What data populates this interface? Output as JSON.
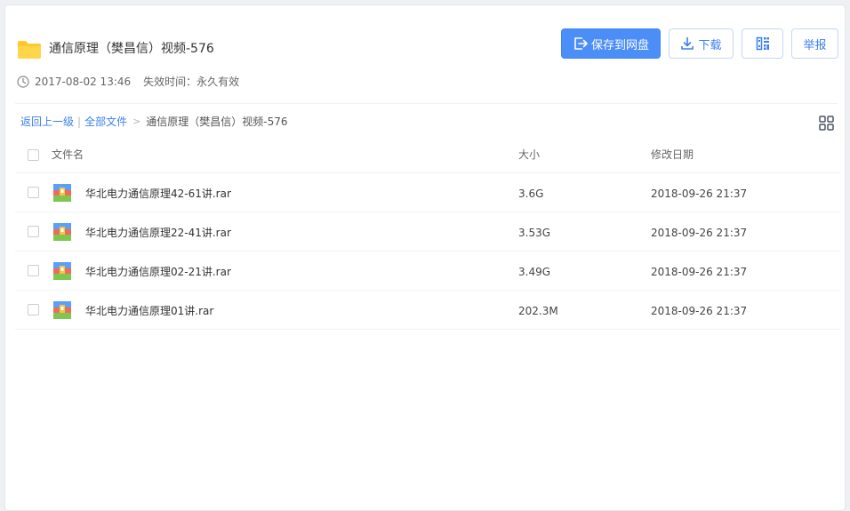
{
  "share": {
    "title": "通信原理（樊昌信）视频-576",
    "date": "2017-08-02 13:46",
    "expire_label": "失效时间：",
    "expire_value": "永久有效"
  },
  "actions": {
    "save_label": "保存到网盘",
    "download_label": "下载",
    "report_label": "举报"
  },
  "breadcrumb": {
    "back": "返回上一级",
    "separator": "|",
    "all_files": "全部文件",
    "arrow": ">",
    "current": "通信原理（樊昌信）视频-576"
  },
  "table": {
    "headers": {
      "name": "文件名",
      "size": "大小",
      "date": "修改日期"
    },
    "rows": [
      {
        "name": "华北电力通信原理42-61讲.rar",
        "size": "3.6G",
        "date": "2018-09-26 21:37"
      },
      {
        "name": "华北电力通信原理22-41讲.rar",
        "size": "3.53G",
        "date": "2018-09-26 21:37"
      },
      {
        "name": "华北电力通信原理02-21讲.rar",
        "size": "3.49G",
        "date": "2018-09-26 21:37"
      },
      {
        "name": "华北电力通信原理01讲.rar",
        "size": "202.3M",
        "date": "2018-09-26 21:37"
      }
    ]
  },
  "icons": {
    "folder": "folder-icon",
    "clock": "clock-icon",
    "save": "save-to-disk-icon",
    "download": "download-icon",
    "qr": "qr-code-icon",
    "grid": "grid-view-icon",
    "rar": "rar-archive-icon"
  },
  "colors": {
    "accent": "#4b8ef8",
    "link": "#3b7ff1",
    "folder": "#ffc928"
  }
}
